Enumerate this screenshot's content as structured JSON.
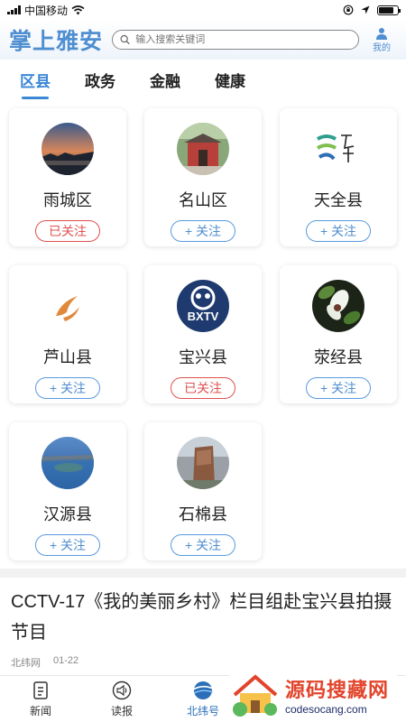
{
  "status": {
    "carrier": "中国移动",
    "battery_level": 0.8
  },
  "header": {
    "logo": "掌上雅安",
    "search_placeholder": "输入搜索关键词",
    "me_label": "我的"
  },
  "tabs": [
    {
      "label": "区县",
      "active": true
    },
    {
      "label": "政务",
      "active": false
    },
    {
      "label": "金融",
      "active": false
    },
    {
      "label": "健康",
      "active": false
    }
  ],
  "counties": [
    {
      "name": "雨城区",
      "button": "已关注",
      "followed": true
    },
    {
      "name": "名山区",
      "button": "+ 关注",
      "followed": false
    },
    {
      "name": "天全县",
      "button": "+ 关注",
      "followed": false
    },
    {
      "name": "芦山县",
      "button": "+ 关注",
      "followed": false
    },
    {
      "name": "宝兴县",
      "button": "已关注",
      "followed": true,
      "logo_text": "BXTV"
    },
    {
      "name": "荥经县",
      "button": "+ 关注",
      "followed": false
    },
    {
      "name": "汉源县",
      "button": "+ 关注",
      "followed": false
    },
    {
      "name": "石棉县",
      "button": "+ 关注",
      "followed": false
    }
  ],
  "news": {
    "title": "CCTV-17《我的美丽乡村》栏目组赴宝兴县拍摄节目",
    "source": "北纬网",
    "date": "01-22"
  },
  "bottom_nav": [
    {
      "label": "新闻",
      "active": false
    },
    {
      "label": "读报",
      "active": false
    },
    {
      "label": "北纬号",
      "active": true
    }
  ],
  "watermark": {
    "cn": "源码搜藏网",
    "url": "codesocang.com"
  },
  "colors": {
    "accent": "#3a87d6",
    "followed": "#e05050",
    "brand": "#4f8ed0"
  }
}
